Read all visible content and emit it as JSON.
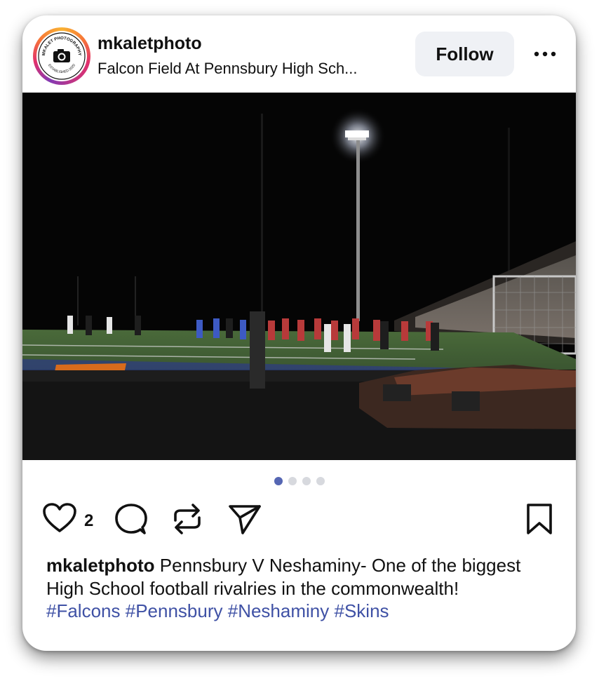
{
  "post": {
    "username": "mkaletphoto",
    "location": "Falcon Field At Pennsbury High Sch...",
    "follow_label": "Follow",
    "avatar_logo_text": {
      "top": "MKALET PHOTOGRAPHY",
      "bottom": "ESTABLISHED 2020"
    },
    "photo_description_icon": "football-stadium-night-photo",
    "carousel": {
      "count": 4,
      "active_index": 0
    },
    "like_count": "2",
    "caption": {
      "username": "mkaletphoto",
      "text": " Pennsbury V Neshaminy- One of the biggest High School football rivalries in the commonwealth! ",
      "hashtags": [
        "#Falcons",
        "#Pennsbury",
        "#Neshaminy",
        "#Skins"
      ]
    }
  },
  "icons": {
    "more": "more-horizontal-icon",
    "like": "heart-icon",
    "comment": "comment-icon",
    "repost": "repost-icon",
    "share": "send-icon",
    "save": "bookmark-icon"
  },
  "colors": {
    "follow_bg": "#eff1f5",
    "hashtag": "#3f51a5",
    "dot_active": "#5566b3",
    "dot_inactive": "#d7d9de"
  }
}
